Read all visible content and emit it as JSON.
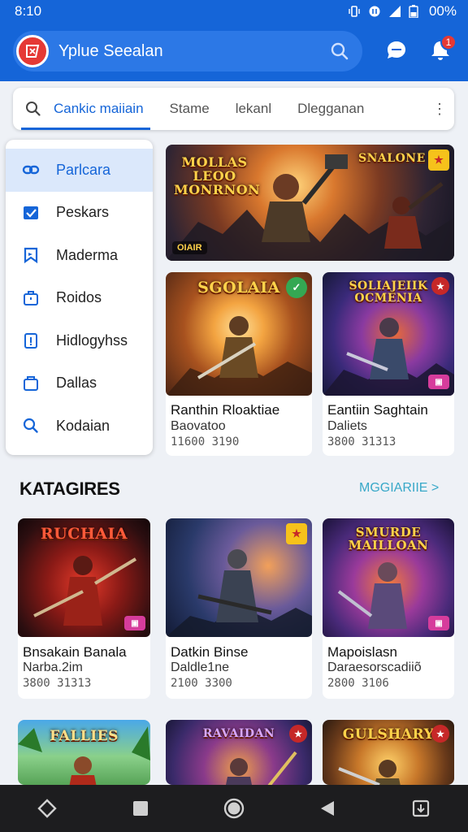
{
  "status_bar": {
    "time": "8:10",
    "battery": "00%"
  },
  "app_bar": {
    "title": "Yplue Seealan",
    "notification_count": "1"
  },
  "tabs": [
    {
      "label": "Cankic maiiain",
      "active": true
    },
    {
      "label": "Stame",
      "active": false
    },
    {
      "label": "lekanl",
      "active": false
    },
    {
      "label": "Dlegganan",
      "active": false
    }
  ],
  "sidebar": {
    "items": [
      {
        "label": "Parlcara",
        "icon": "link-icon",
        "active": true
      },
      {
        "label": "Peskars",
        "icon": "check-box-icon",
        "active": false
      },
      {
        "label": "Maderma",
        "icon": "bookmark-flag-icon",
        "active": false
      },
      {
        "label": "Roidos",
        "icon": "briefcase-icon",
        "active": false
      },
      {
        "label": "Hidlogyhss",
        "icon": "document-icon",
        "active": false
      },
      {
        "label": "Dallas",
        "icon": "folder-icon",
        "active": false
      },
      {
        "label": "Kodaian",
        "icon": "search-icon",
        "active": false
      }
    ]
  },
  "featured": {
    "banner": {
      "art_title": "MOLLAS LEOO MONRNON",
      "tag": "OIAIR",
      "side_title": "SNALONE"
    },
    "cards": [
      {
        "art_title": "SGOLAIA",
        "title": "Ranthin Rloaktiae",
        "subtitle": "Baovatoo",
        "meta": "11600 3190"
      },
      {
        "art_title": "SOLIAJEIIK OCMENIA",
        "title": "Eantiin Saghtain",
        "subtitle": "Daliets",
        "meta": "3800 31313"
      }
    ]
  },
  "section": {
    "title": "KATAGIRES",
    "link": "MGGIARIIE >"
  },
  "grid": [
    {
      "art_title": "RUCHAIA",
      "title": "Bnsakain Banala",
      "subtitle": "Narba.2im",
      "meta": "3800 31313"
    },
    {
      "art_title": "",
      "title": "Datkin Binse",
      "subtitle": "Daldle1ne",
      "meta": "2100 3300"
    },
    {
      "art_title": "SMURDE MAILLOAN",
      "title": "Mapoislasn",
      "subtitle": "Daraesorscadiiõ",
      "meta": "2800 3106"
    },
    {
      "art_title": "FALLIES",
      "title": "",
      "subtitle": "",
      "meta": ""
    },
    {
      "art_title": "RAVAIDAN",
      "title": "",
      "subtitle": "",
      "meta": ""
    },
    {
      "art_title": "GULSHARY",
      "title": "",
      "subtitle": "",
      "meta": ""
    }
  ],
  "colors": {
    "primary": "#1565d8",
    "accent_link": "#38a8c8",
    "nav_bar": "#1d1d1f",
    "badge": "#e53935"
  }
}
